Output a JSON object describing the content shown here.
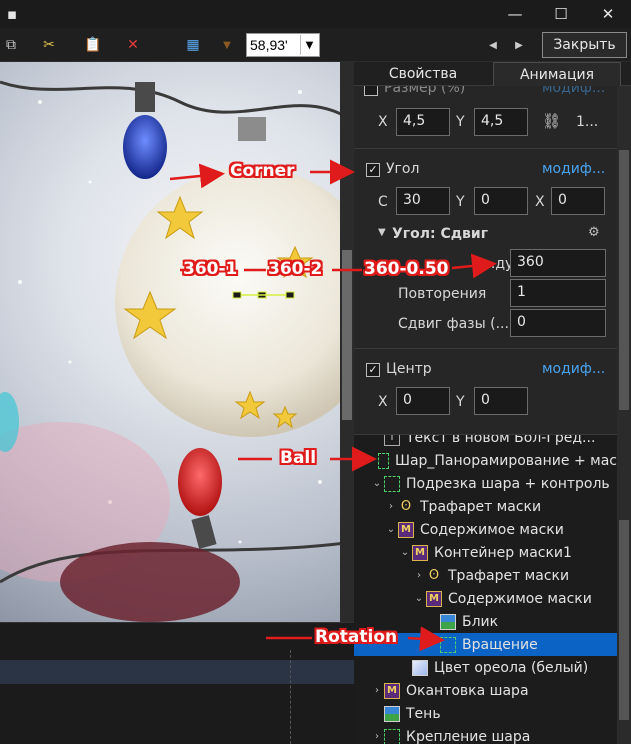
{
  "toolbar": {
    "zoom_value": "58,93'",
    "close_label": "Закрыть"
  },
  "tabs": [
    {
      "label": "Свойства"
    },
    {
      "label": "Анимация"
    }
  ],
  "properties": {
    "size": {
      "label": "Размер (%)",
      "link": "модиф...",
      "x_label": "X",
      "x_value": "4,5",
      "y_label": "Y",
      "y_value": "4,5",
      "extra": "1..."
    },
    "angle": {
      "label": "Угол",
      "link": "модиф...",
      "c_label": "С",
      "c_value": "30",
      "y_label": "Y",
      "y_value": "0",
      "x_label": "X",
      "x_value": "0"
    },
    "angle_shift": {
      "title": "Угол: Сдвиг",
      "duration_label": "...ду",
      "duration_value": "360",
      "repeat_label": "Повторения",
      "repeat_value": "1",
      "phase_label": "Сдвиг фазы (...",
      "phase_value": "0"
    },
    "center": {
      "label": "Центр",
      "link": "модиф...",
      "x_label": "X",
      "x_value": "0",
      "y_label": "Y",
      "y_value": "0"
    }
  },
  "tree": {
    "items": [
      {
        "label": "Текст в новом Бол-Гред...",
        "icon": "text-icon"
      },
      {
        "label": "Шар_Панорамирование + мас",
        "icon": "dashed-frame-icon"
      },
      {
        "label": "Подрезка шара + контроль",
        "icon": "dashed-frame-icon"
      },
      {
        "label": "Трафарет маски",
        "icon": "stencil-icon"
      },
      {
        "label": "Содержимое маски",
        "icon": "mask-icon"
      },
      {
        "label": "Контейнер маски1",
        "icon": "mask-icon"
      },
      {
        "label": "Трафарет маски",
        "icon": "stencil-icon"
      },
      {
        "label": "Содержимое маски",
        "icon": "mask-icon"
      },
      {
        "label": "Блик",
        "icon": "image-icon"
      },
      {
        "label": "Вращение",
        "icon": "dashed-frame-icon"
      },
      {
        "label": "Цвет ореола (белый)",
        "icon": "color-icon"
      },
      {
        "label": "Окантовка шара",
        "icon": "mask-icon"
      },
      {
        "label": "Тень",
        "icon": "image-icon"
      },
      {
        "label": "Крепление шара",
        "icon": "dashed-frame-icon"
      }
    ]
  },
  "annotations": {
    "corner": "Corner",
    "a1": "360-1",
    "a2": "360-2",
    "a3": "360-0.50",
    "ball": "Ball",
    "rotation": "Rotation"
  },
  "colors": {
    "selection": "#0b63c5",
    "link": "#4aa3f0",
    "annotation": "#e01b1b"
  }
}
